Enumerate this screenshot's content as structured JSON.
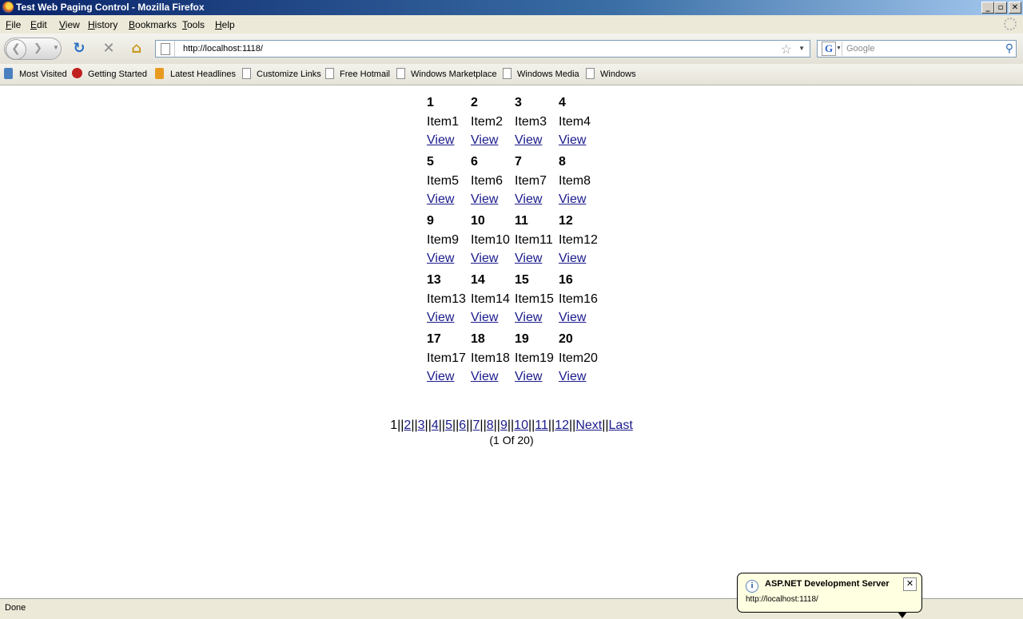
{
  "window": {
    "title": "Test Web Paging Control - Mozilla Firefox",
    "min": "_",
    "max": "▫",
    "close": "✕"
  },
  "menu": {
    "file": "File",
    "edit": "Edit",
    "view": "View",
    "history": "History",
    "bookmarks": "Bookmarks",
    "tools": "Tools",
    "help": "Help"
  },
  "nav": {
    "url": "http://localhost:1118/",
    "search_placeholder": "Google"
  },
  "bookmarks_bar": {
    "most_visited": "Most Visited",
    "getting_started": "Getting Started",
    "latest_headlines": "Latest Headlines",
    "customize_links": "Customize Links",
    "free_hotmail": "Free Hotmail",
    "windows_marketplace": "Windows Marketplace",
    "windows_media": "Windows Media",
    "windows": "Windows"
  },
  "items": [
    {
      "num": "1",
      "name": "Item1",
      "view": "View"
    },
    {
      "num": "2",
      "name": "Item2",
      "view": "View"
    },
    {
      "num": "3",
      "name": "Item3",
      "view": "View"
    },
    {
      "num": "4",
      "name": "Item4",
      "view": "View"
    },
    {
      "num": "5",
      "name": "Item5",
      "view": "View"
    },
    {
      "num": "6",
      "name": "Item6",
      "view": "View"
    },
    {
      "num": "7",
      "name": "Item7",
      "view": "View"
    },
    {
      "num": "8",
      "name": "Item8",
      "view": "View"
    },
    {
      "num": "9",
      "name": "Item9",
      "view": "View"
    },
    {
      "num": "10",
      "name": "Item10",
      "view": "View"
    },
    {
      "num": "11",
      "name": "Item11",
      "view": "View"
    },
    {
      "num": "12",
      "name": "Item12",
      "view": "View"
    },
    {
      "num": "13",
      "name": "Item13",
      "view": "View"
    },
    {
      "num": "14",
      "name": "Item14",
      "view": "View"
    },
    {
      "num": "15",
      "name": "Item15",
      "view": "View"
    },
    {
      "num": "16",
      "name": "Item16",
      "view": "View"
    },
    {
      "num": "17",
      "name": "Item17",
      "view": "View"
    },
    {
      "num": "18",
      "name": "Item18",
      "view": "View"
    },
    {
      "num": "19",
      "name": "Item19",
      "view": "View"
    },
    {
      "num": "20",
      "name": "Item20",
      "view": "View"
    }
  ],
  "pager": {
    "current": "1",
    "separator": "||",
    "pages": [
      "2",
      "3",
      "4",
      "5",
      "6",
      "7",
      "8",
      "9",
      "10",
      "11",
      "12"
    ],
    "next": "Next",
    "last": "Last",
    "info": "(1 Of 20)"
  },
  "status": {
    "text": "Done"
  },
  "balloon": {
    "title": "ASP.NET Development Server",
    "url": "http://localhost:1118/",
    "close": "✕"
  }
}
